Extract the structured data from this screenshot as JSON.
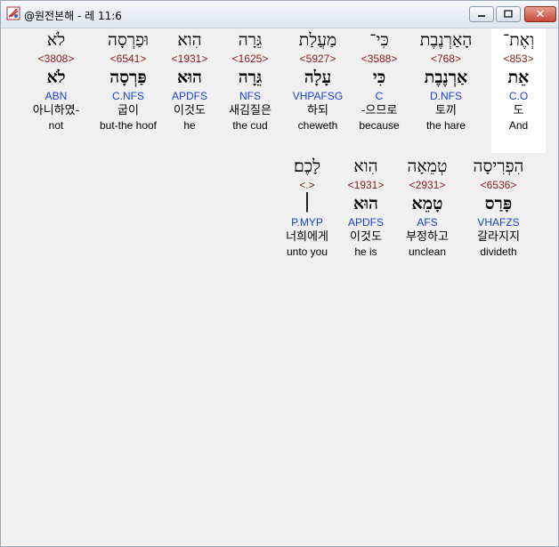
{
  "window": {
    "title": "@원전본해 - 레 11:6",
    "icon": "bible-app-icon"
  },
  "rows": [
    [
      {
        "word": "וְאֶת־",
        "strong": "<853>",
        "lemma": "אֵת",
        "parse": "C.O",
        "korean": "도",
        "english": "And",
        "selected": true
      },
      {
        "word": "הָאַרְנֶבֶת",
        "strong": "<768>",
        "lemma": "אַרְנֶבֶת",
        "parse": "D.NFS",
        "korean": "토끼",
        "english": "the hare"
      },
      {
        "word": "כִּי־",
        "strong": "<3588>",
        "lemma": "כִּי",
        "parse": "C",
        "korean": "-으므로",
        "english": "because"
      },
      {
        "word": "מַעֲלַת",
        "strong": "<5927>",
        "lemma": "עָלָה",
        "parse": "VHPAFSG",
        "korean": "하되",
        "english": "cheweth"
      },
      {
        "word": "גֵּרָה",
        "strong": "<1625>",
        "lemma": "גֵּרָה",
        "parse": "NFS",
        "korean": "새김질은",
        "english": "the cud"
      },
      {
        "word": "הִוא",
        "strong": "<1931>",
        "lemma": "הוּא",
        "parse": "APDFS",
        "korean": "이것도",
        "english": "he"
      },
      {
        "word": "וּפַרְסָה",
        "strong": "<6541>",
        "lemma": "פַּרְסָה",
        "parse": "C.NFS",
        "korean": "굽이",
        "english": "but-the hoof"
      },
      {
        "word": "לֹא",
        "strong": "<3808>",
        "lemma": "לֹא",
        "parse": "ABN",
        "korean": "아니하였-",
        "english": "not"
      }
    ],
    [
      {
        "word": "הִפְרִיסָה",
        "strong": "<6536>",
        "lemma": "פָּרַס",
        "parse": "VHAFZS",
        "korean": "갈라지지",
        "english": "divideth"
      },
      {
        "word": "טְמֵאָה",
        "strong": "<2931>",
        "lemma": "טָמֵא",
        "parse": "AFS",
        "korean": "부정하고",
        "english": "unclean"
      },
      {
        "word": "הִוא",
        "strong": "<1931>",
        "lemma": "הוּא",
        "parse": "APDFS",
        "korean": "이것도",
        "english": "he is"
      },
      {
        "word": "לָכֶם׃",
        "strong": "<.>",
        "lemma": "׀",
        "parse": "P.MYP",
        "korean": "너희에게",
        "english": "unto you"
      }
    ]
  ]
}
